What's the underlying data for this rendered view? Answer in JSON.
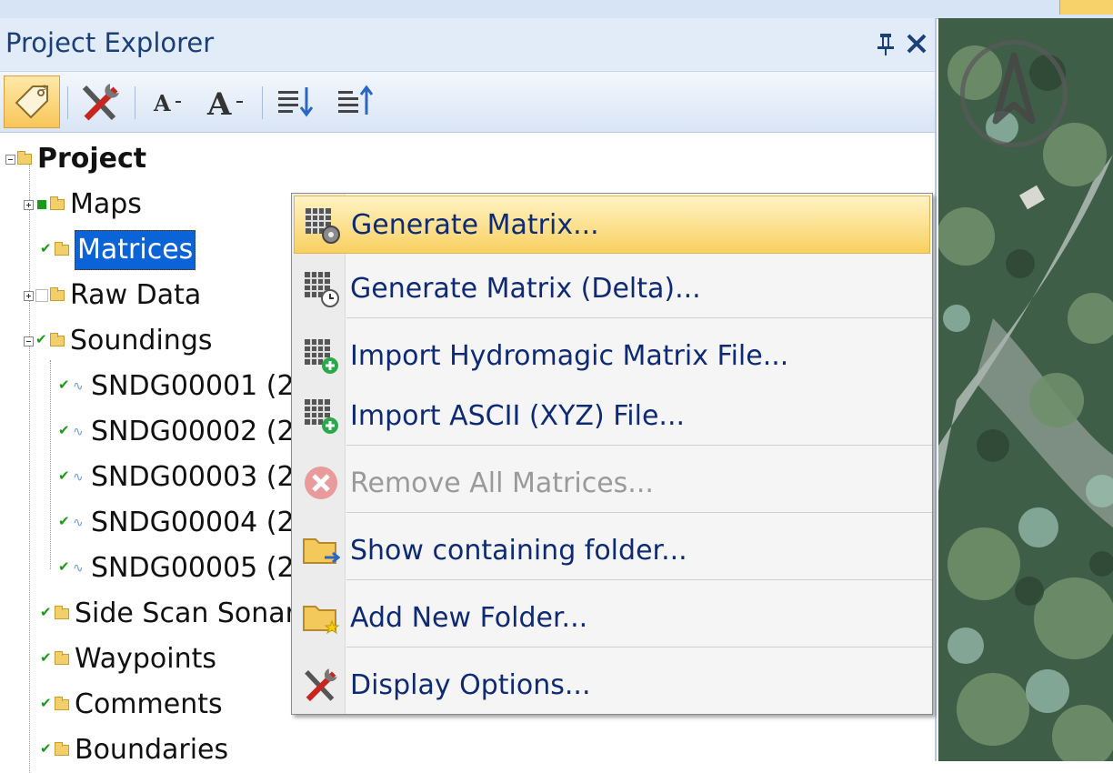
{
  "window": {
    "accent_color": "#f7d26a"
  },
  "explorer": {
    "title": "Project Explorer",
    "toolbar": {
      "buttons": [
        {
          "name": "tag-icon",
          "active": true
        },
        {
          "name": "display-options-icon",
          "active": false
        },
        {
          "name": "font-decrease-icon",
          "active": false
        },
        {
          "name": "font-increase-icon",
          "active": false
        },
        {
          "name": "sort-descending-icon",
          "active": false
        },
        {
          "name": "sort-ascending-icon",
          "active": false
        }
      ]
    },
    "tree": {
      "root": "Project",
      "items": [
        {
          "label": "Maps",
          "expander": "plus",
          "check": "partial"
        },
        {
          "label": "Matrices",
          "expander": "none",
          "check": "on",
          "selected": true
        },
        {
          "label": "Raw Data",
          "expander": "plus",
          "check": "empty"
        },
        {
          "label": "Soundings",
          "expander": "minus",
          "check": "on"
        },
        {
          "label": "Side Scan Sonar",
          "expander": "none",
          "check": "on"
        },
        {
          "label": "Waypoints",
          "expander": "none",
          "check": "on"
        },
        {
          "label": "Comments",
          "expander": "none",
          "check": "on"
        },
        {
          "label": "Boundaries",
          "expander": "none",
          "check": "on"
        }
      ],
      "soundings": [
        "SNDG00001 (2",
        "SNDG00002 (2",
        "SNDG00003 (2",
        "SNDG00004 (2",
        "SNDG00005 (2"
      ]
    }
  },
  "context_menu": {
    "items": [
      {
        "label": "Generate Matrix...",
        "icon": "matrix-gear-icon",
        "highlighted": true,
        "disabled": false
      },
      {
        "label": "Generate Matrix (Delta)...",
        "icon": "matrix-clock-icon",
        "highlighted": false,
        "disabled": false
      },
      {
        "label": "Import Hydromagic Matrix File...",
        "icon": "matrix-add-icon",
        "highlighted": false,
        "disabled": false
      },
      {
        "label": "Import ASCII (XYZ) File...",
        "icon": "matrix-add-icon",
        "highlighted": false,
        "disabled": false
      },
      {
        "label": "Remove All Matrices...",
        "icon": "remove-icon",
        "highlighted": false,
        "disabled": true
      },
      {
        "label": "Show containing folder...",
        "icon": "folder-arrow-icon",
        "highlighted": false,
        "disabled": false
      },
      {
        "label": "Add New Folder...",
        "icon": "new-folder-icon",
        "highlighted": false,
        "disabled": false
      },
      {
        "label": "Display Options...",
        "icon": "tools-icon",
        "highlighted": false,
        "disabled": false
      }
    ]
  },
  "colors": {
    "title_text": "#1b3f77",
    "menu_text": "#0e2a74",
    "selection": "#0a64d8",
    "checkmark": "#1a9a1a"
  }
}
